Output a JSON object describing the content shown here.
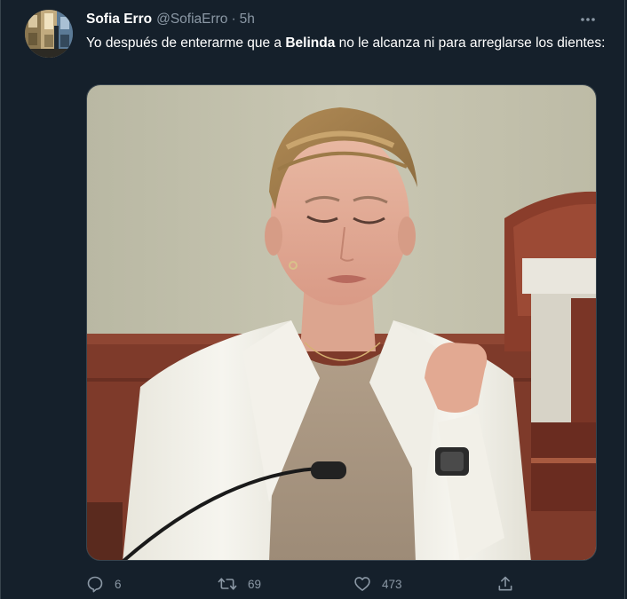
{
  "tweet": {
    "author": {
      "display_name": "Sofia Erro",
      "handle": "@SofiaErro",
      "separator": "·",
      "time": "5h"
    },
    "text": {
      "part1": "Yo después de enterarme que a ",
      "bold": "Belinda",
      "part2": " no le alcanza ni para arreglarse los dientes:"
    },
    "media": {
      "alt": "Photo of a woman in a white blazer in a courtroom looking at her fingernails"
    },
    "actions": {
      "replies": "6",
      "retweets": "69",
      "likes": "473"
    }
  },
  "icons": {
    "more": "more-horizontal-icon",
    "reply": "reply-icon",
    "retweet": "retweet-icon",
    "like": "heart-icon",
    "share": "share-icon"
  },
  "colors": {
    "background": "#15202b",
    "border": "#38444d",
    "secondary_text": "#8b98a5",
    "primary_text": "#ffffff"
  }
}
